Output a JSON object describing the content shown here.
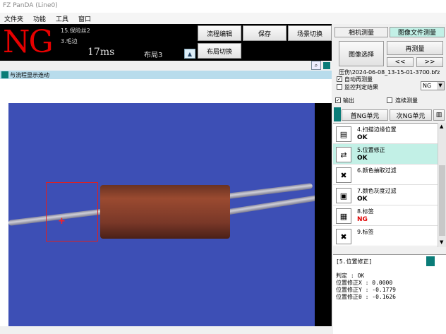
{
  "window": {
    "title": "FZ PanDA (Line0)"
  },
  "menu": [
    "文件夹",
    "功能",
    "工具",
    "窗口"
  ],
  "status": {
    "judgement": "NG",
    "step_primary": "15.保险丝2",
    "step_secondary": "3.毛边",
    "time": "17ms",
    "layout": "布局3"
  },
  "toolbar": {
    "flow_edit": "流程编辑",
    "save": "保存",
    "scene_switch": "场景切换",
    "layout_switch": "布局切换"
  },
  "image_pane": {
    "sync_label": "与流程显示连动"
  },
  "right_panel": {
    "tabs": [
      "相机测量",
      "图像文件测量"
    ],
    "image_select": "图像选择",
    "remeasure": "再测量",
    "prev": "<<",
    "next": ">>",
    "file_path": "压伤\\2024-06-08_13-15-01-3700.bfz",
    "auto_remeasure": "自动再测量",
    "monitor_result": "监控判定结果",
    "monitor_value": "NG",
    "output": "输出",
    "continuous": "连续测量",
    "first_ng": "首NG单元",
    "next_ng": "次NG单元"
  },
  "flow_items": [
    {
      "title": "4.扫描边缘位置",
      "status": "OK",
      "color": "#000000",
      "highlight": false,
      "icon": "edge-scan-icon",
      "glyph": "▤"
    },
    {
      "title": "5.位置修正",
      "status": "OK",
      "color": "#000000",
      "highlight": true,
      "icon": "position-compensation-icon",
      "glyph": "⇄"
    },
    {
      "title": "6.颜色抽取过滤",
      "status": "",
      "color": "#000000",
      "highlight": false,
      "icon": "color-extract-icon",
      "glyph": "✖"
    },
    {
      "title": "7.颜色灰度过滤",
      "status": "OK",
      "color": "#000000",
      "highlight": false,
      "icon": "gray-filter-icon",
      "glyph": "▣"
    },
    {
      "title": "8.标签",
      "status": "NG",
      "color": "#e00000",
      "highlight": false,
      "icon": "label-icon",
      "glyph": "▦"
    },
    {
      "title": "9.标签",
      "status": "",
      "color": "#000000",
      "highlight": false,
      "icon": "label-icon",
      "glyph": "✖"
    }
  ],
  "detail": {
    "header": "[5.位置修正]",
    "lines": [
      "判定 : OK",
      "位置修正X : 0.0000",
      "位置修正Y : -0.1779",
      "位置修正θ : -0.1626"
    ]
  }
}
